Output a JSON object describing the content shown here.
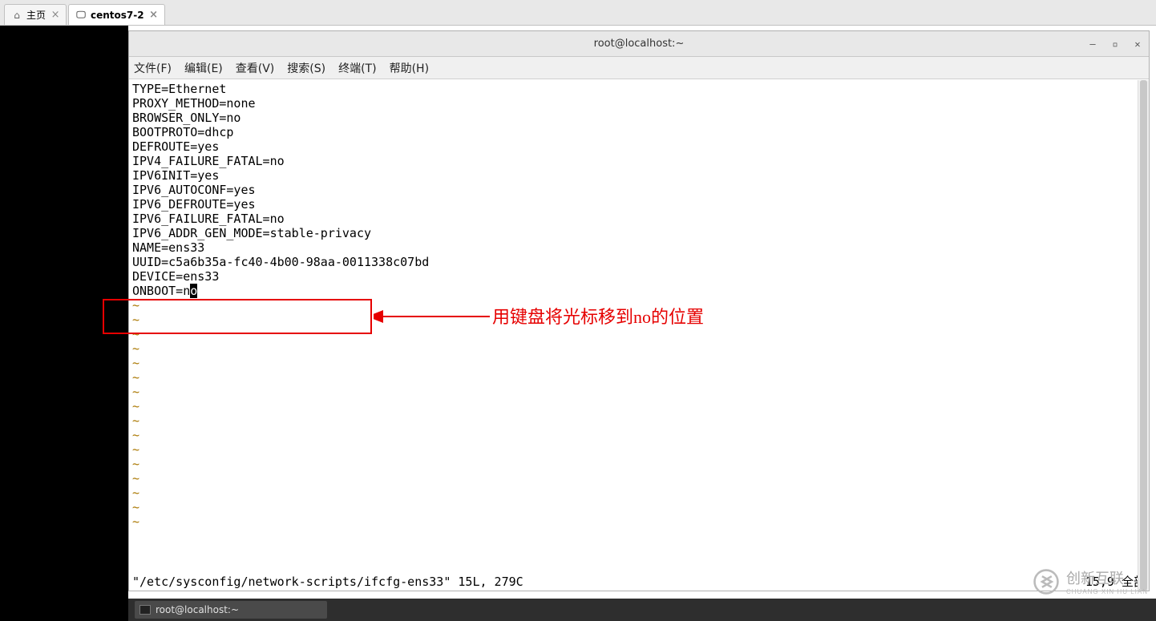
{
  "tabs": [
    {
      "label": "主页",
      "icon": "home"
    },
    {
      "label": "centos7-2",
      "icon": "vm"
    }
  ],
  "window": {
    "title": "root@localhost:~"
  },
  "menu": {
    "file": "文件(F)",
    "edit": "编辑(E)",
    "view": "查看(V)",
    "search": "搜索(S)",
    "terminal": "终端(T)",
    "help": "帮助(H)"
  },
  "config_lines": [
    "TYPE=Ethernet",
    "PROXY_METHOD=none",
    "BROWSER_ONLY=no",
    "BOOTPROTO=dhcp",
    "DEFROUTE=yes",
    "IPV4_FAILURE_FATAL=no",
    "IPV6INIT=yes",
    "IPV6_AUTOCONF=yes",
    "IPV6_DEFROUTE=yes",
    "IPV6_FAILURE_FATAL=no",
    "IPV6_ADDR_GEN_MODE=stable-privacy",
    "NAME=ens33",
    "UUID=c5a6b35a-fc40-4b00-98aa-0011338c07bd",
    "DEVICE=ens33"
  ],
  "cursor_line": {
    "prefix": "ONBOOT=n",
    "cursor": "o",
    "suffix": ""
  },
  "empty_count": 16,
  "status": {
    "left": "\"/etc/sysconfig/network-scripts/ifcfg-ens33\" 15L, 279C",
    "right": "15,9          全部"
  },
  "annotation": {
    "text": "用键盘将光标移到no的位置"
  },
  "taskbar": {
    "item0": "root@localhost:~"
  },
  "watermark": {
    "text_top": "创新互联",
    "text_bottom": "CHUANG XIN HU LIAN"
  }
}
